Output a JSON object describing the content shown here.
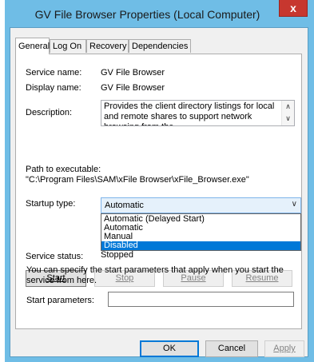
{
  "window": {
    "title": "GV File Browser Properties (Local Computer)",
    "close_glyph": "x"
  },
  "tabs": [
    {
      "label": "General",
      "active": true
    },
    {
      "label": "Log On",
      "active": false
    },
    {
      "label": "Recovery",
      "active": false
    },
    {
      "label": "Dependencies",
      "active": false
    }
  ],
  "general": {
    "service_name_label": "Service name:",
    "service_name": "GV File Browser",
    "display_name_label": "Display name:",
    "display_name": "GV File Browser",
    "description_label": "Description:",
    "description": "Provides the client directory listings for local and remote shares to support network browsing from the",
    "path_label": "Path to executable:",
    "path": "\"C:\\Program Files\\SAM\\xFile Browser\\xFile_Browser.exe\"",
    "startup_type_label": "Startup type:",
    "startup_type_value": "Automatic",
    "startup_options": [
      "Automatic (Delayed Start)",
      "Automatic",
      "Manual",
      "Disabled"
    ],
    "highlighted_option": "Disabled",
    "service_status_label": "Service status:",
    "service_status": "Stopped",
    "start_label": "Start",
    "stop_label": "Stop",
    "pause_label": "Pause",
    "resume_label": "Resume",
    "note": "You can specify the start parameters that apply when you start the service from here.",
    "start_params_label": "Start parameters:",
    "start_params_value": ""
  },
  "footer": {
    "ok_label": "OK",
    "cancel_label": "Cancel",
    "apply_label": "Apply"
  },
  "colors": {
    "title_bar": "#6fbde6",
    "close_button": "#c7372f",
    "selection": "#0078d7"
  }
}
